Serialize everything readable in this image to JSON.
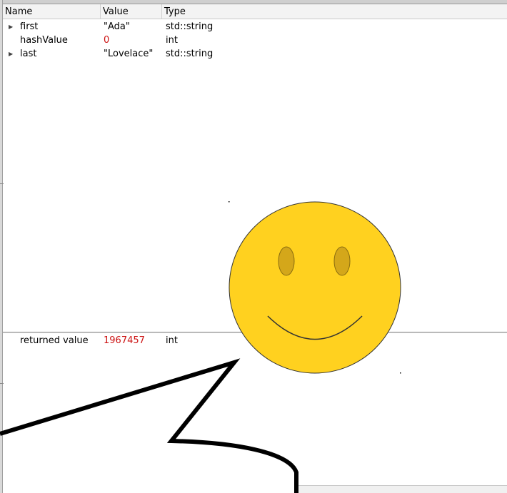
{
  "header": {
    "name_label": "Name",
    "value_label": "Value",
    "type_label": "Type"
  },
  "locals": [
    {
      "name": "first",
      "value": "\"Ada\"",
      "type": "std::string",
      "expandable": true
    },
    {
      "name": "hashValue",
      "value": "0",
      "type": "int",
      "expandable": false
    },
    {
      "name": "last",
      "value": "\"Lovelace\"",
      "type": "std::string",
      "expandable": true
    }
  ],
  "returned": {
    "name": "returned value",
    "value": "1967457",
    "type": "int"
  },
  "colors": {
    "changed_value": "#cc1111",
    "smiley_face": "#ffd11f",
    "smiley_eyes": "#d4a71a"
  }
}
